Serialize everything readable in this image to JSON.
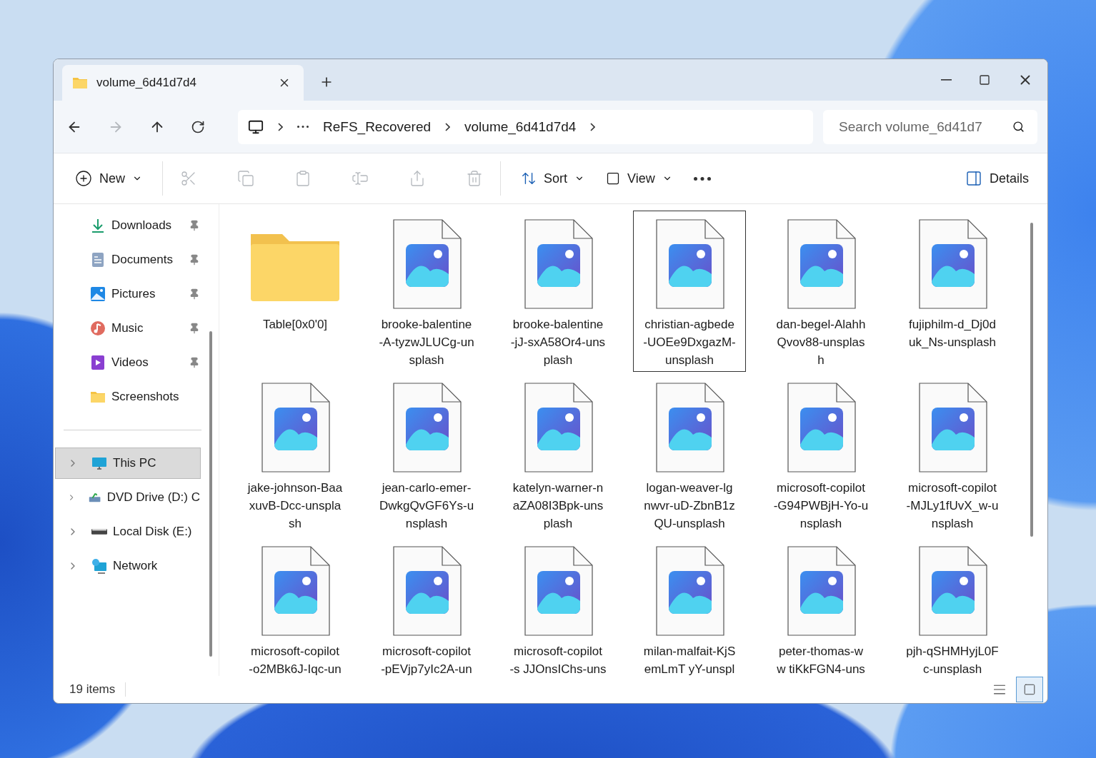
{
  "window": {
    "tab": {
      "title": "volume_6d41d7d4"
    }
  },
  "nav": {
    "breadcrumb": [
      "ReFS_Recovered",
      "volume_6d41d7d4"
    ],
    "search": {
      "placeholder": "Search volume_6d41d7"
    }
  },
  "commands": {
    "new": "New",
    "sort": "Sort",
    "view": "View",
    "details": "Details"
  },
  "sidebar": {
    "quick_access": [
      {
        "label": "Downloads",
        "pinned": true,
        "kind": "download"
      },
      {
        "label": "Documents",
        "pinned": true,
        "kind": "document"
      },
      {
        "label": "Pictures",
        "pinned": true,
        "kind": "pictures"
      },
      {
        "label": "Music",
        "pinned": true,
        "kind": "music"
      },
      {
        "label": "Videos",
        "pinned": true,
        "kind": "videos"
      },
      {
        "label": "Screenshots",
        "pinned": false,
        "kind": "folder"
      }
    ],
    "locations": [
      {
        "label": "This PC",
        "selected": true,
        "kind": "pc"
      },
      {
        "label": "DVD Drive (D:) C",
        "selected": false,
        "kind": "dvd"
      },
      {
        "label": "Local Disk (E:)",
        "selected": false,
        "kind": "disk"
      },
      {
        "label": "Network",
        "selected": false,
        "kind": "network"
      }
    ]
  },
  "files": [
    {
      "kind": "folder",
      "lines": [
        "Table[0x0'0]"
      ],
      "selected": false
    },
    {
      "kind": "image",
      "lines": [
        "brooke-balentine",
        "-A-tyzwJLUCg-un",
        "splash"
      ],
      "selected": false
    },
    {
      "kind": "image",
      "lines": [
        "brooke-balentine",
        "-jJ-sxA58Or4-uns",
        "plash"
      ],
      "selected": false
    },
    {
      "kind": "image",
      "lines": [
        "christian-agbede",
        "-UOEe9DxgazM-",
        "unsplash"
      ],
      "selected": true
    },
    {
      "kind": "image",
      "lines": [
        "dan-begel-Alahh",
        "Qvov88-unsplas",
        "h"
      ],
      "selected": false
    },
    {
      "kind": "image",
      "lines": [
        "fujiphilm-d_Dj0d",
        "uk_Ns-unsplash"
      ],
      "selected": false
    },
    {
      "kind": "image",
      "lines": [
        "jake-johnson-Baa",
        "xuvB-Dcc-unspla",
        "sh"
      ],
      "selected": false
    },
    {
      "kind": "image",
      "lines": [
        "jean-carlo-emer-",
        "DwkgQvGF6Ys-u",
        "nsplash"
      ],
      "selected": false
    },
    {
      "kind": "image",
      "lines": [
        "katelyn-warner-n",
        "aZA08I3Bpk-uns",
        "plash"
      ],
      "selected": false
    },
    {
      "kind": "image",
      "lines": [
        "logan-weaver-lg",
        "nwvr-uD-ZbnB1z",
        "QU-unsplash"
      ],
      "selected": false
    },
    {
      "kind": "image",
      "lines": [
        "microsoft-copilot",
        "-G94PWBjH-Yo-u",
        "nsplash"
      ],
      "selected": false
    },
    {
      "kind": "image",
      "lines": [
        "microsoft-copilot",
        "-MJLy1fUvX_w-u",
        "nsplash"
      ],
      "selected": false
    },
    {
      "kind": "image",
      "lines": [
        "microsoft-copilot",
        "-o2MBk6J-Iqc-un"
      ],
      "selected": false
    },
    {
      "kind": "image",
      "lines": [
        "microsoft-copilot",
        "-pEVjp7yIc2A-un"
      ],
      "selected": false
    },
    {
      "kind": "image",
      "lines": [
        "microsoft-copilot",
        "-s JJOnsIChs-uns"
      ],
      "selected": false
    },
    {
      "kind": "image",
      "lines": [
        "milan-malfait-KjS",
        "emLmT yY-unspl"
      ],
      "selected": false
    },
    {
      "kind": "image",
      "lines": [
        "peter-thomas-w",
        "w tiKkFGN4-uns"
      ],
      "selected": false
    },
    {
      "kind": "image",
      "lines": [
        "pjh-qSHMHyjL0F",
        "c-unsplash"
      ],
      "selected": false
    }
  ],
  "status_bar": {
    "count": "19 items"
  }
}
